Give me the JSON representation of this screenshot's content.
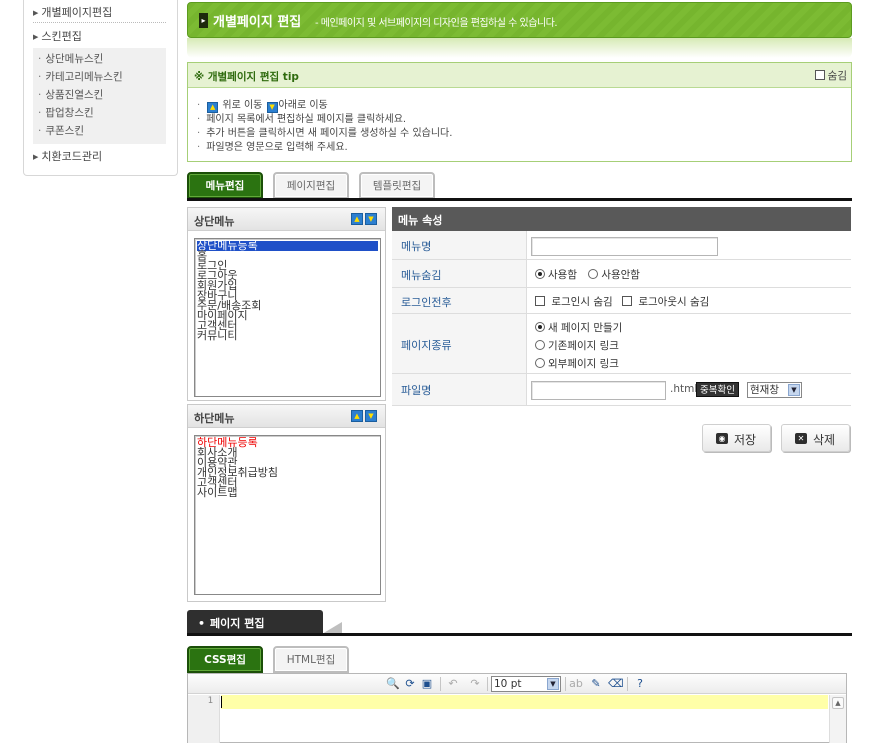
{
  "sidebar": {
    "items": [
      {
        "label": "개별페이지편집"
      },
      {
        "label": "스킨편집"
      },
      {
        "label": "치환코드관리"
      }
    ],
    "sub_items": [
      {
        "label": "상단메뉴스킨"
      },
      {
        "label": "카테고리메뉴스킨"
      },
      {
        "label": "상품진열스킨"
      },
      {
        "label": "팝업창스킨"
      },
      {
        "label": "쿠폰스킨"
      }
    ]
  },
  "header": {
    "title": "개별페이지 편집",
    "description": "- 메인페이지 및 서브페이지의 디자인을 편집하실 수 있습니다."
  },
  "tip": {
    "title": "※ 개별페이지 편집 tip",
    "hide_label": "숨김",
    "up_text": "위로 이동",
    "down_text": "아래로 이동",
    "lines": [
      "페이지 목록에서 편집하실 페이지를 클릭하세요.",
      "추가 버튼을 클릭하시면 새 페이지를 생성하실 수 있습니다.",
      "파일명은 영문으로 입력해 주세요."
    ]
  },
  "tabs": [
    {
      "label": "메뉴편집",
      "active": true
    },
    {
      "label": "페이지편집",
      "active": false
    },
    {
      "label": "템플릿편집",
      "active": false
    }
  ],
  "top_menu": {
    "title": "상단메뉴",
    "items": [
      "상단메뉴등록",
      "홈",
      "로그인",
      "로그아웃",
      "회원가입",
      "장바구니",
      "주문/배송조회",
      "마이페이지",
      "고객센터",
      "커뮤니티"
    ]
  },
  "bottom_menu": {
    "title": "하단메뉴",
    "items": [
      "하단메뉴등록",
      "회사소개",
      "이용약관",
      "개인정보취급방침",
      "고객센터",
      "사이트맵"
    ]
  },
  "props": {
    "title": "메뉴 속성",
    "menu_name_label": "메뉴명",
    "menu_name_value": "",
    "hide_label": "메뉴숨김",
    "hide_options": [
      "사용함",
      "사용안함"
    ],
    "hide_selected": 0,
    "login_label": "로그인전후",
    "login_options": [
      "로그인시 숨김",
      "로그아웃시 숨김"
    ],
    "pagetype_label": "페이지종류",
    "pagetype_options": [
      "새 페이지 만들기",
      "기존페이지 링크",
      "외부페이지 링크"
    ],
    "pagetype_selected": 0,
    "filename_label": "파일명",
    "filename_value": "",
    "filename_ext": ".html",
    "dup_check": "중복확인",
    "target_value": "현재창"
  },
  "actions": {
    "save": "저장",
    "delete": "삭제"
  },
  "page_edit": {
    "title": "페이지 편집",
    "tabs": [
      {
        "label": "CSS편집",
        "active": true
      },
      {
        "label": "HTML편집",
        "active": false
      }
    ],
    "font_size": "10 pt",
    "line_number": "1"
  },
  "colors": {
    "accent_green": "#76b52e",
    "tab_active": "#2b7311",
    "label_blue": "#2a5d98",
    "highlight_line": "#ffffa8"
  }
}
